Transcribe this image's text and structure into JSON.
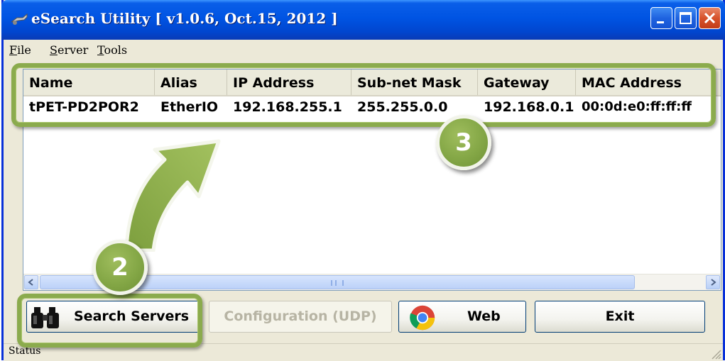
{
  "window": {
    "title": "eSearch Utility [ v1.0.6, Oct.15, 2012 ]"
  },
  "menu": [
    {
      "label": "File",
      "accel": "F",
      "rest": "ile"
    },
    {
      "label": "Server",
      "accel": "S",
      "rest": "erver"
    },
    {
      "label": "Tools",
      "accel": "T",
      "rest": "ools"
    }
  ],
  "table": {
    "columns": [
      "Name",
      "Alias",
      "IP Address",
      "Sub-net Mask",
      "Gateway",
      "MAC Address"
    ],
    "rows": [
      [
        "tPET-PD2POR2",
        "EtherIO",
        "192.168.255.1",
        "255.255.0.0",
        "192.168.0.1",
        "00:0d:e0:ff:ff:ff"
      ]
    ]
  },
  "scrollbar": {
    "grip": "III"
  },
  "buttons": {
    "search": "Search Servers",
    "config": "Configuration (UDP)",
    "web": "Web",
    "exit": "Exit"
  },
  "status": "Status",
  "annotations": {
    "badge_2": "2",
    "badge_3": "3",
    "highlight_color": "#8bab4d"
  },
  "colors": {
    "titlebar": "#0054e3",
    "window_bg": "#ece9d8",
    "close_button": "#d7522b"
  }
}
